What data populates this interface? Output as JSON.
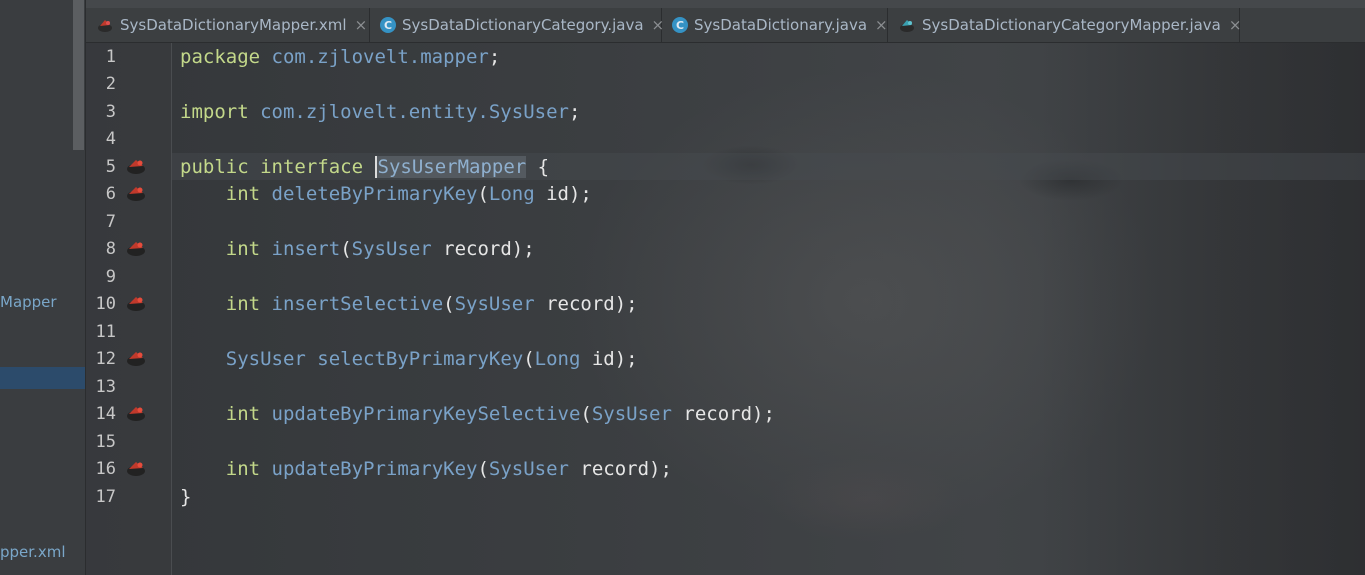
{
  "project_panel": {
    "items": [
      "Mapper",
      "pper.xml"
    ]
  },
  "tabs": [
    {
      "label": "SysDataDictionaryMapper.xml",
      "icon": "mybatis-icon",
      "close": "×"
    },
    {
      "label": "SysDataDictionaryCategory.java",
      "icon": "java-class-icon",
      "close": "×"
    },
    {
      "label": "SysDataDictionary.java",
      "icon": "java-class-icon",
      "close": "×"
    },
    {
      "label": "SysDataDictionaryCategoryMapper.java",
      "icon": "mybatis-interface-icon",
      "close": "×"
    }
  ],
  "class_icon_letter": "C",
  "line_numbers": [
    "1",
    "2",
    "3",
    "4",
    "5",
    "6",
    "7",
    "8",
    "9",
    "10",
    "11",
    "12",
    "13",
    "14",
    "15",
    "16",
    "17"
  ],
  "code": {
    "l1": {
      "kw": "package",
      "pkg": "com.zjlovelt.mapper",
      "end": ";"
    },
    "l3": {
      "kw": "import",
      "pkg": "com.zjlovelt.entity.SysUser",
      "end": ";"
    },
    "l5": {
      "kw1": "public",
      "kw2": "interface",
      "name": "SysUserMapper",
      "end": "{"
    },
    "l6": {
      "ret": "int",
      "method": "deleteByPrimaryKey",
      "ptype": "Long",
      "rest": " id);"
    },
    "l8": {
      "ret": "int",
      "method": "insert",
      "ptype": "SysUser",
      "rest": " record);"
    },
    "l10": {
      "ret": "int",
      "method": "insertSelective",
      "ptype": "SysUser",
      "rest": " record);"
    },
    "l12": {
      "ret": "SysUser",
      "method": "selectByPrimaryKey",
      "ptype": "Long",
      "rest": " id);"
    },
    "l14": {
      "ret": "int",
      "method": "updateByPrimaryKeySelective",
      "ptype": "SysUser",
      "rest": " record);"
    },
    "l16": {
      "ret": "int",
      "method": "updateByPrimaryKey",
      "ptype": "SysUser",
      "rest": " record);"
    },
    "l17": {
      "text": "}"
    }
  },
  "colors": {
    "keyword": "#c3d88a",
    "identifier": "#7aa2c8",
    "text": "#e6e6e6",
    "background": "#3a3d40"
  }
}
